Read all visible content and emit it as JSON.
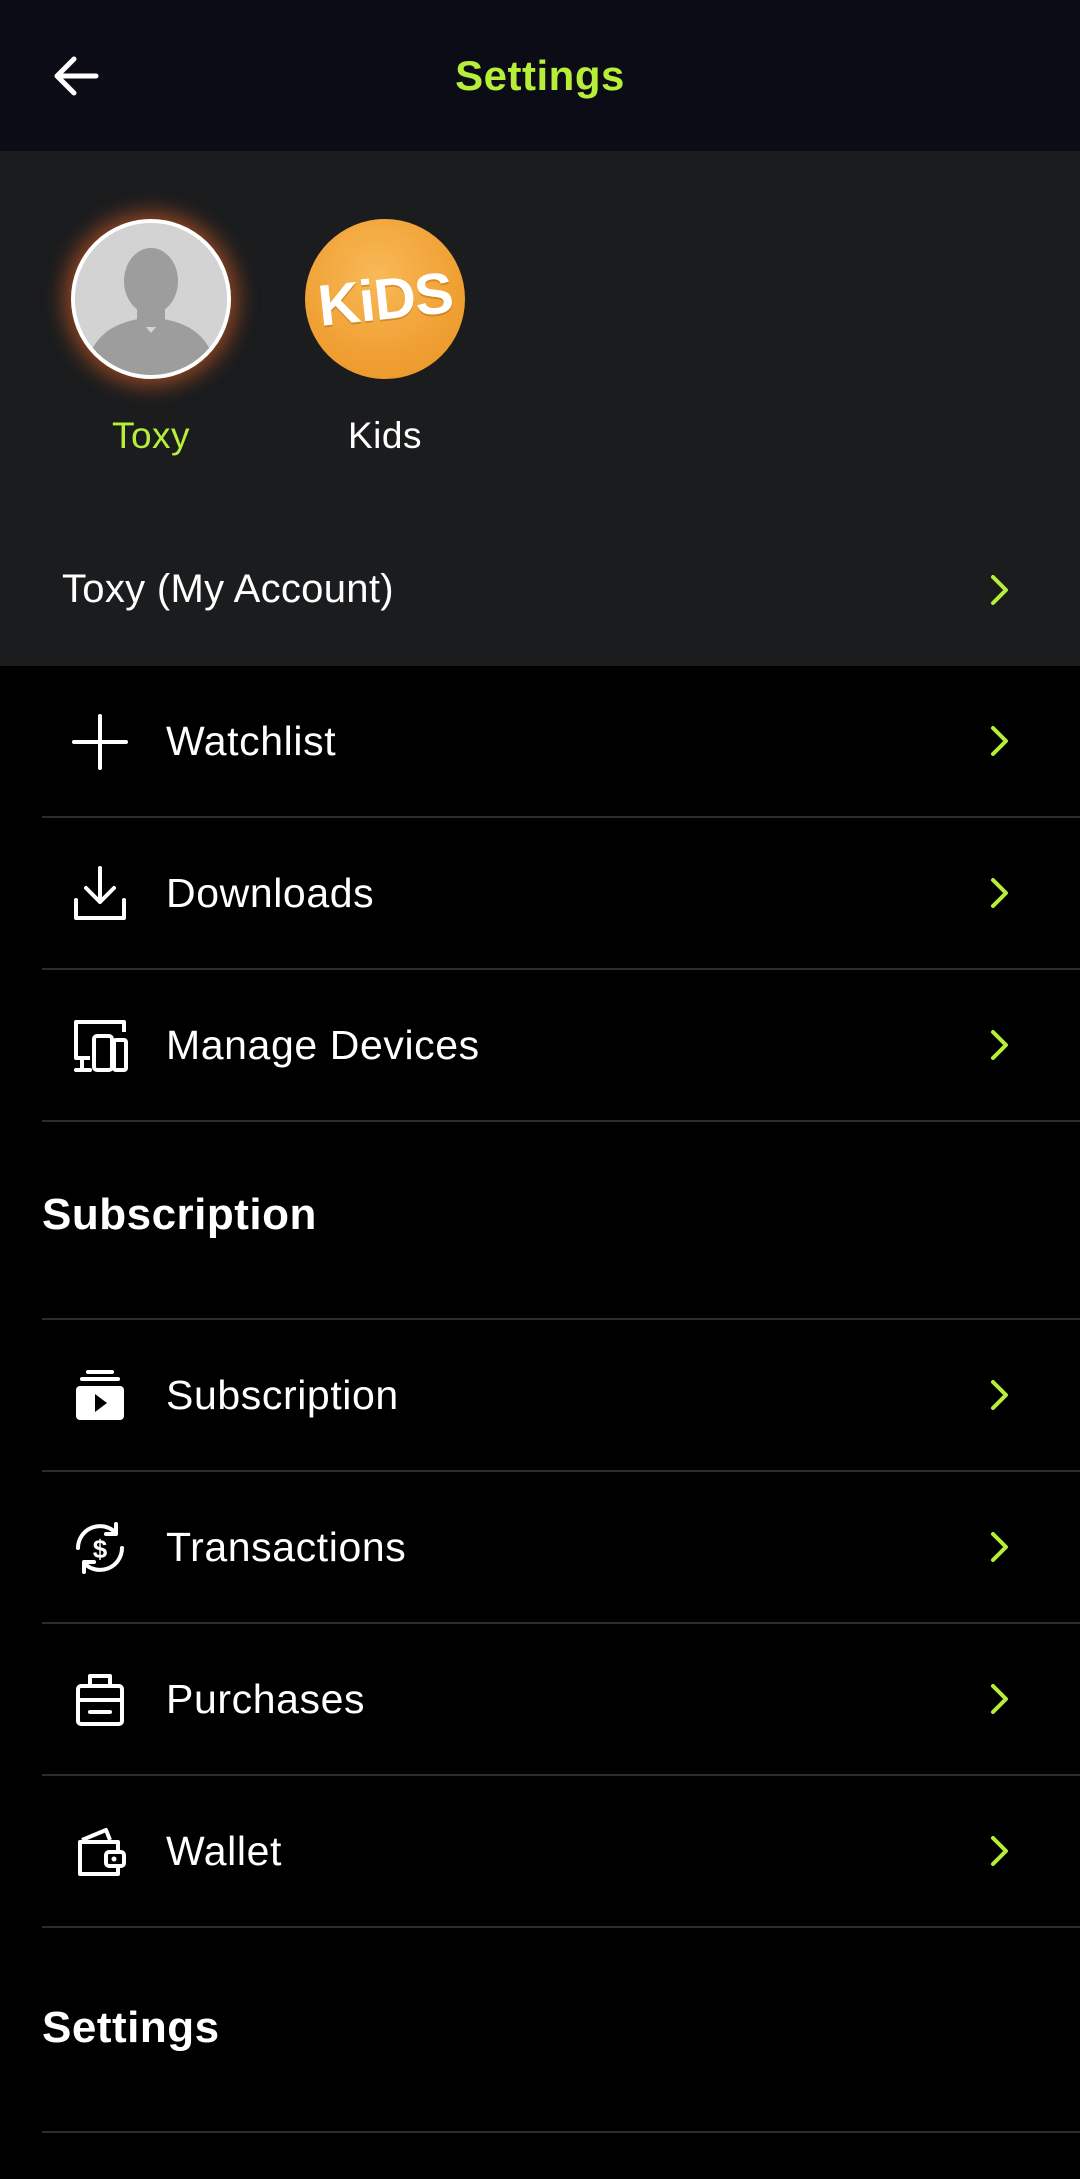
{
  "header": {
    "title": "Settings",
    "back_icon": "arrow-left-icon"
  },
  "profiles": [
    {
      "name": "Toxy",
      "active": true,
      "avatar": "default-user-avatar"
    },
    {
      "name": "Kids",
      "active": false,
      "avatar": "kids-logo",
      "logo_text": "KiDS"
    }
  ],
  "account": {
    "label": "Toxy (My Account)"
  },
  "menu": [
    {
      "label": "Watchlist",
      "icon": "plus-icon"
    },
    {
      "label": "Downloads",
      "icon": "download-icon"
    },
    {
      "label": "Manage Devices",
      "icon": "devices-icon"
    }
  ],
  "subscription_section": {
    "title": "Subscription",
    "items": [
      {
        "label": "Subscription",
        "icon": "subscription-icon"
      },
      {
        "label": "Transactions",
        "icon": "transactions-icon"
      },
      {
        "label": "Purchases",
        "icon": "purchases-icon"
      },
      {
        "label": "Wallet",
        "icon": "wallet-icon"
      }
    ]
  },
  "settings_section": {
    "title": "Settings"
  },
  "colors": {
    "accent": "#b7ee3a",
    "header_bg": "#0c0c17",
    "panel_bg": "#1a1c1e",
    "background": "#000000",
    "divider": "#2c2c2c"
  }
}
